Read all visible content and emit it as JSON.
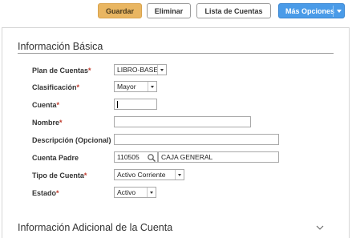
{
  "toolbar": {
    "guardar_label": "Guardar",
    "eliminar_label": "Eliminar",
    "lista_label": "Lista de Cuentas",
    "mas_label": "Más Opciones"
  },
  "sections": {
    "basic_title": "Información Básica",
    "additional_title": "Información Adicional de la Cuenta"
  },
  "form": {
    "plan": {
      "label": "Plan de Cuentas",
      "value": "LIBRO-BASE"
    },
    "clasificacion": {
      "label": "Clasificación",
      "value": "Mayor"
    },
    "cuenta": {
      "label": "Cuenta",
      "value": ""
    },
    "nombre": {
      "label": "Nombre",
      "value": ""
    },
    "descripcion": {
      "label": "Descripción (Opcional)",
      "value": ""
    },
    "padre": {
      "label": "Cuenta Padre",
      "code": "110505",
      "name": "CAJA GENERAL"
    },
    "tipo": {
      "label": "Tipo de Cuenta",
      "value": "Activo Corriente"
    },
    "estado": {
      "label": "Estado",
      "value": "Activo"
    },
    "required_mark": "*"
  },
  "colors": {
    "primary": "#4a9be8",
    "save": "#e9b662",
    "required": "#c0392b"
  }
}
